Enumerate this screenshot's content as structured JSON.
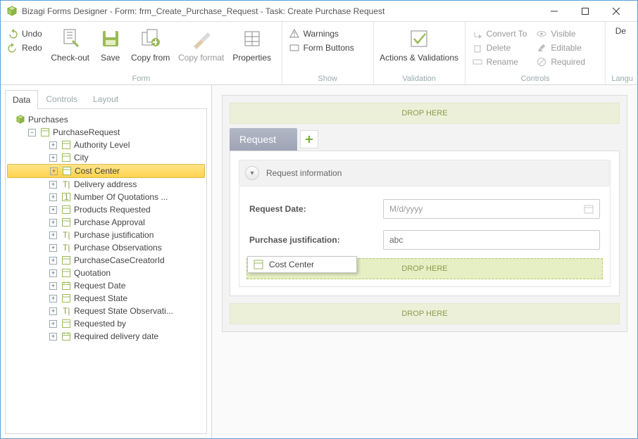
{
  "title": "Bizagi Forms Designer  -  Form: frm_Create_Purchase_Request - Task:  Create Purchase Request",
  "ribbon": {
    "undo": "Undo",
    "redo": "Redo",
    "checkout": "Check-out",
    "save": "Save",
    "copyfrom": "Copy from",
    "copyformat": "Copy format",
    "properties": "Properties",
    "warnings": "Warnings",
    "formbuttons": "Form Buttons",
    "actions": "Actions & Validations",
    "convert": "Convert To",
    "delete": "Delete",
    "rename": "Rename",
    "visible": "Visible",
    "editable": "Editable",
    "required": "Required",
    "def": "De",
    "group_form": "Form",
    "group_show": "Show",
    "group_validation": "Validation",
    "group_controls": "Controls",
    "group_lang": "Langu"
  },
  "side": {
    "tab_data": "Data",
    "tab_controls": "Controls",
    "tab_layout": "Layout",
    "root": "Purchases",
    "entity": "PurchaseRequest",
    "items": [
      "Authority Level",
      "City",
      "Cost Center",
      "Delivery address",
      "Number Of Quotations ...",
      "Products Requested",
      "Purchase Approval",
      "Purchase justification",
      "Purchase Observations",
      "PurchaseCaseCreatorId",
      "Quotation",
      "Request Date",
      "Request State",
      "Request State Observati...",
      "Requested by",
      "Required delivery date"
    ],
    "selected_index": 2
  },
  "form": {
    "drop_here": "DROP HERE",
    "tab_request": "Request",
    "section_title": "Request information",
    "field1_label": "Request Date:",
    "field1_placeholder": "M/d/yyyy",
    "field2_label": "Purchase justification:",
    "field2_value": "abc",
    "drag_item": "Cost Center"
  }
}
